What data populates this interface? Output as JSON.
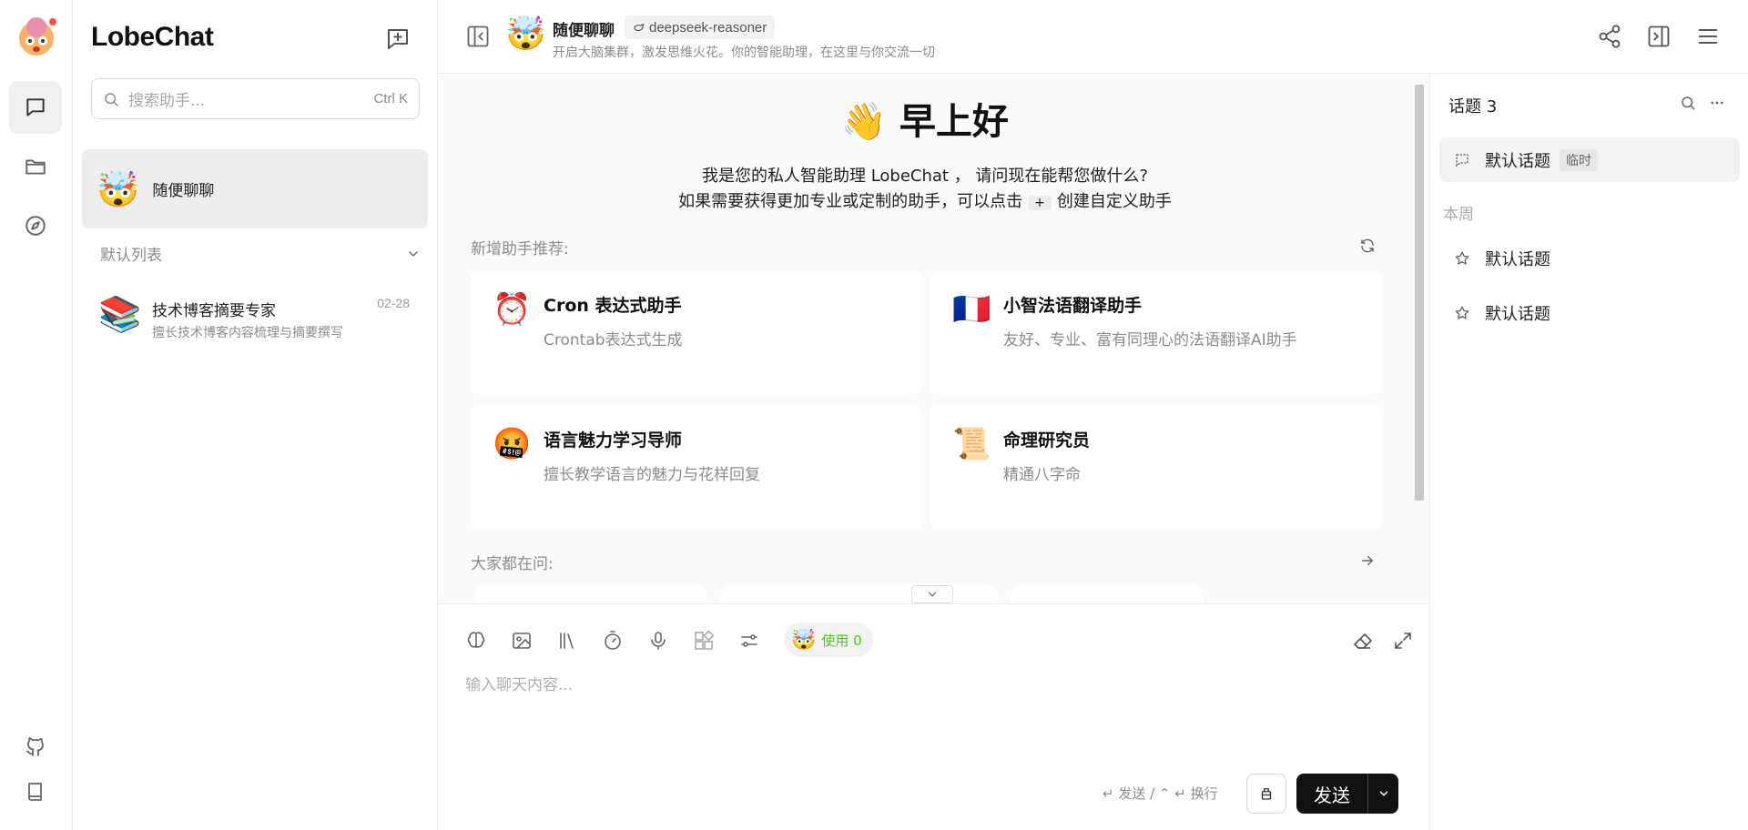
{
  "app": {
    "name": "LobeChat"
  },
  "colors": {
    "send_bg": "#111111",
    "usage_green": "#52c41a",
    "active_bg": "#ededed"
  },
  "sidebar": {
    "search": {
      "placeholder": "搜索助手...",
      "shortcut": "Ctrl K"
    },
    "active_session": {
      "label": "随便聊聊",
      "emoji": "🤯"
    },
    "group": {
      "label": "默认列表"
    },
    "sessions": [
      {
        "title": "技术博客摘要专家",
        "description": "擅长技术博客内容梳理与摘要撰写",
        "date": "02-28",
        "emoji": "📚"
      }
    ]
  },
  "header": {
    "title": "随便聊聊",
    "model": "deepseek-reasoner",
    "description": "开启大脑集群，激发思维火花。你的智能助理，在这里与你交流一切"
  },
  "welcome": {
    "wave": "👋",
    "greeting": "早上好",
    "line1": "我是您的私人智能助理 LobeChat ， 请问现在能帮您做什么?",
    "line2_pre": "如果需要获得更加专业或定制的助手，可以点击",
    "plus": "+",
    "line2_post": "创建自定义助手",
    "recommend_label": "新增助手推荐:",
    "questions_label": "大家都在问:",
    "cards": [
      {
        "emoji": "⏰",
        "title": "Cron 表达式助手",
        "desc": "Crontab表达式生成"
      },
      {
        "emoji": "🇫🇷",
        "title": "小智法语翻译助手",
        "desc": "友好、专业、富有同理心的法语翻译AI助手"
      },
      {
        "emoji": "🤬",
        "title": "语言魅力学习导师",
        "desc": "擅长教学语言的魅力与花样回复"
      },
      {
        "emoji": "📜",
        "title": "命理研究员",
        "desc": "精通八字命"
      }
    ]
  },
  "input": {
    "usage_label": "使用 0",
    "usage_emoji": "🤯",
    "placeholder": "输入聊天内容...",
    "hint": "↵ 发送 / ⌃ ↵ 换行",
    "send_label": "发送"
  },
  "topics": {
    "header": "话题 3",
    "active": {
      "name": "默认话题",
      "tag": "临时"
    },
    "week_label": "本周",
    "items": [
      {
        "name": "默认话题"
      },
      {
        "name": "默认话题"
      }
    ]
  }
}
